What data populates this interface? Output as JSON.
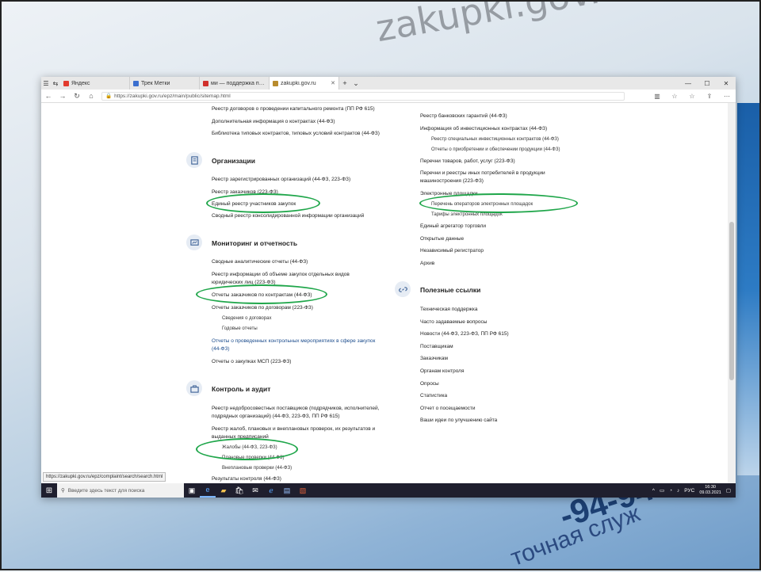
{
  "background": {
    "url_text": "zakupki.gov.ru/epz/main/public/home.htm",
    "phone_text": "-94-94",
    "service_text": "точная служ"
  },
  "browser": {
    "tabs": [
      {
        "label": "Яндекс",
        "fav_color": "#e23b2e",
        "active": false
      },
      {
        "label": "Трек Метки",
        "fav_color": "#3b6fcf",
        "active": false
      },
      {
        "label": "ми — поддержка поставщи",
        "fav_color": "#d0302b",
        "active": false
      },
      {
        "label": "zakupki.gov.ru",
        "fav_color": "#b88b2d",
        "active": true
      }
    ],
    "url": "https://zakupki.gov.ru/epz/main/public/sitemap.html",
    "status_url": "https://zakupki.gov.ru/epz/complaint/search/search.html"
  },
  "left_col": {
    "top_links": [
      "Реестр договоров о проведении капитального ремонта (ПП РФ 615)",
      "Дополнительная информация о контрактах (44-ФЗ)",
      "Библиотека типовых контрактов, типовых условий контрактов (44-ФЗ)"
    ],
    "organizations": {
      "title": "Организации",
      "links": [
        "Реестр зарегистрированных организаций (44-ФЗ, 223-ФЗ)",
        "Реестр заказчиков (223-ФЗ)",
        "Единый реестр участников закупок",
        "Сводный реестр консолидированной информации организаций"
      ]
    },
    "monitoring": {
      "title": "Мониторинг и отчетность",
      "links": [
        "Сводные аналитические отчеты (44-ФЗ)",
        "Реестр информации об объеме закупок отдельных видов",
        "юридических лиц (223-ФЗ)",
        "Отчеты заказчиков по контрактам (44-ФЗ)",
        "Отчеты заказчиков по договорам (223-ФЗ)",
        "Сведения о договорах",
        "Годовые отчеты",
        "Отчеты о проведенных контрольных мероприятиях в сфере закупок",
        "(44-ФЗ)",
        "Отчеты о закупках МСП (223-ФЗ)"
      ]
    },
    "control": {
      "title": "Контроль и аудит",
      "links": [
        "Реестр недобросовестных поставщиков (подрядчиков, исполнителей,",
        "подрядных организаций) (44-ФЗ, 223-ФЗ, ПП РФ 615)",
        "Реестр жалоб, плановых и внеплановых проверок, их результатов и",
        "выданных предписаний",
        "Жалобы (44-ФЗ, 223-ФЗ)",
        "Плановые проверки (44-ФЗ)",
        "Внеплановые проверки (44-ФЗ)",
        "Результаты контроля (44-ФЗ)"
      ]
    }
  },
  "right_col": {
    "top_links": [
      "Реестр банковских гарантий (44-ФЗ)",
      "Информация об инвестиционных контрактах (44-ФЗ)",
      "Реестр специальных инвестиционных контрактов (44-ФЗ)",
      "Отчеты о приобретении и обеспечении продукции (44-ФЗ)",
      "Перечни товаров, работ, услуг (223-ФЗ)",
      "Перечни и реестры иных потребителей в продукции",
      "машиностроения (223-ФЗ)",
      "Электронные площадки",
      "Перечень операторов электронных площадок",
      "Тарифы электронных площадок",
      "Единый агрегатор торговли",
      "Открытые данные",
      "Независимый регистратор",
      "Архив"
    ],
    "useful": {
      "title": "Полезные ссылки",
      "links": [
        "Техническая поддержка",
        "Часто задаваемые вопросы",
        "Новости (44-ФЗ, 223-ФЗ, ПП РФ 615)",
        "Поставщикам",
        "Заказчикам",
        "Органам контроля",
        "Опросы",
        "Статистика",
        "Отчет о посещаемости",
        "Ваши идеи по улучшению сайта"
      ]
    }
  },
  "taskbar": {
    "search_placeholder": "Введите здесь текст для поиска",
    "time": "16:30",
    "date": "09.03.2021",
    "lang": "РУС"
  },
  "colors": {
    "highlight": "#1fa64a",
    "link_blue": "#1a4b8c"
  }
}
